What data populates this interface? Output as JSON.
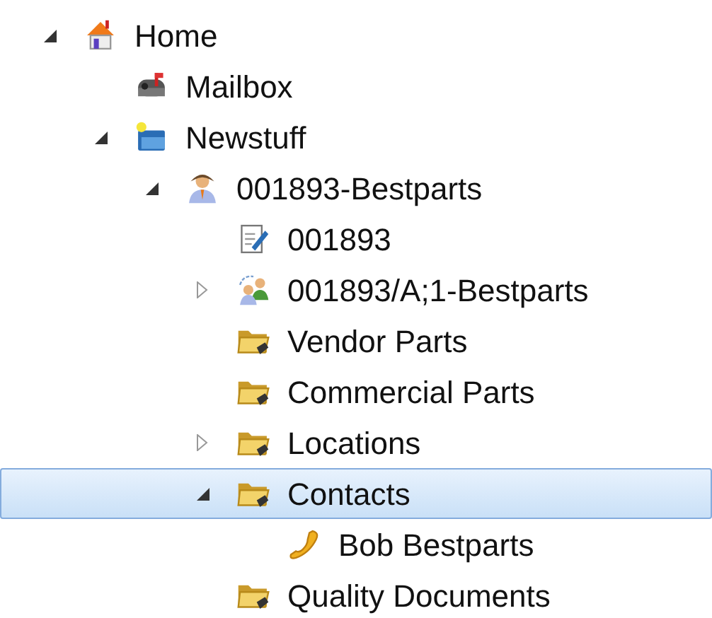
{
  "tree": [
    {
      "label": "Home",
      "kind": "home",
      "expanded": true,
      "selected": false,
      "children": [
        {
          "label": "Mailbox",
          "kind": "mailbox",
          "selected": false
        },
        {
          "label": "Newstuff",
          "kind": "new-folder",
          "expanded": true,
          "selected": false,
          "children": [
            {
              "label": "001893-Bestparts",
              "kind": "person",
              "expanded": true,
              "selected": false,
              "children": [
                {
                  "label": "001893",
                  "kind": "document",
                  "selected": false
                },
                {
                  "label": "001893/A;1-Bestparts",
                  "kind": "group",
                  "expanded": false,
                  "selected": false
                },
                {
                  "label": "Vendor Parts",
                  "kind": "folder",
                  "selected": false
                },
                {
                  "label": "Commercial Parts",
                  "kind": "folder",
                  "selected": false
                },
                {
                  "label": "Locations",
                  "kind": "folder",
                  "expanded": false,
                  "selected": false
                },
                {
                  "label": "Contacts",
                  "kind": "folder",
                  "expanded": true,
                  "selected": true,
                  "children": [
                    {
                      "label": "Bob Bestparts",
                      "kind": "phone",
                      "selected": false
                    }
                  ]
                },
                {
                  "label": "Quality Documents",
                  "kind": "folder",
                  "selected": false
                }
              ]
            }
          ]
        }
      ]
    }
  ]
}
